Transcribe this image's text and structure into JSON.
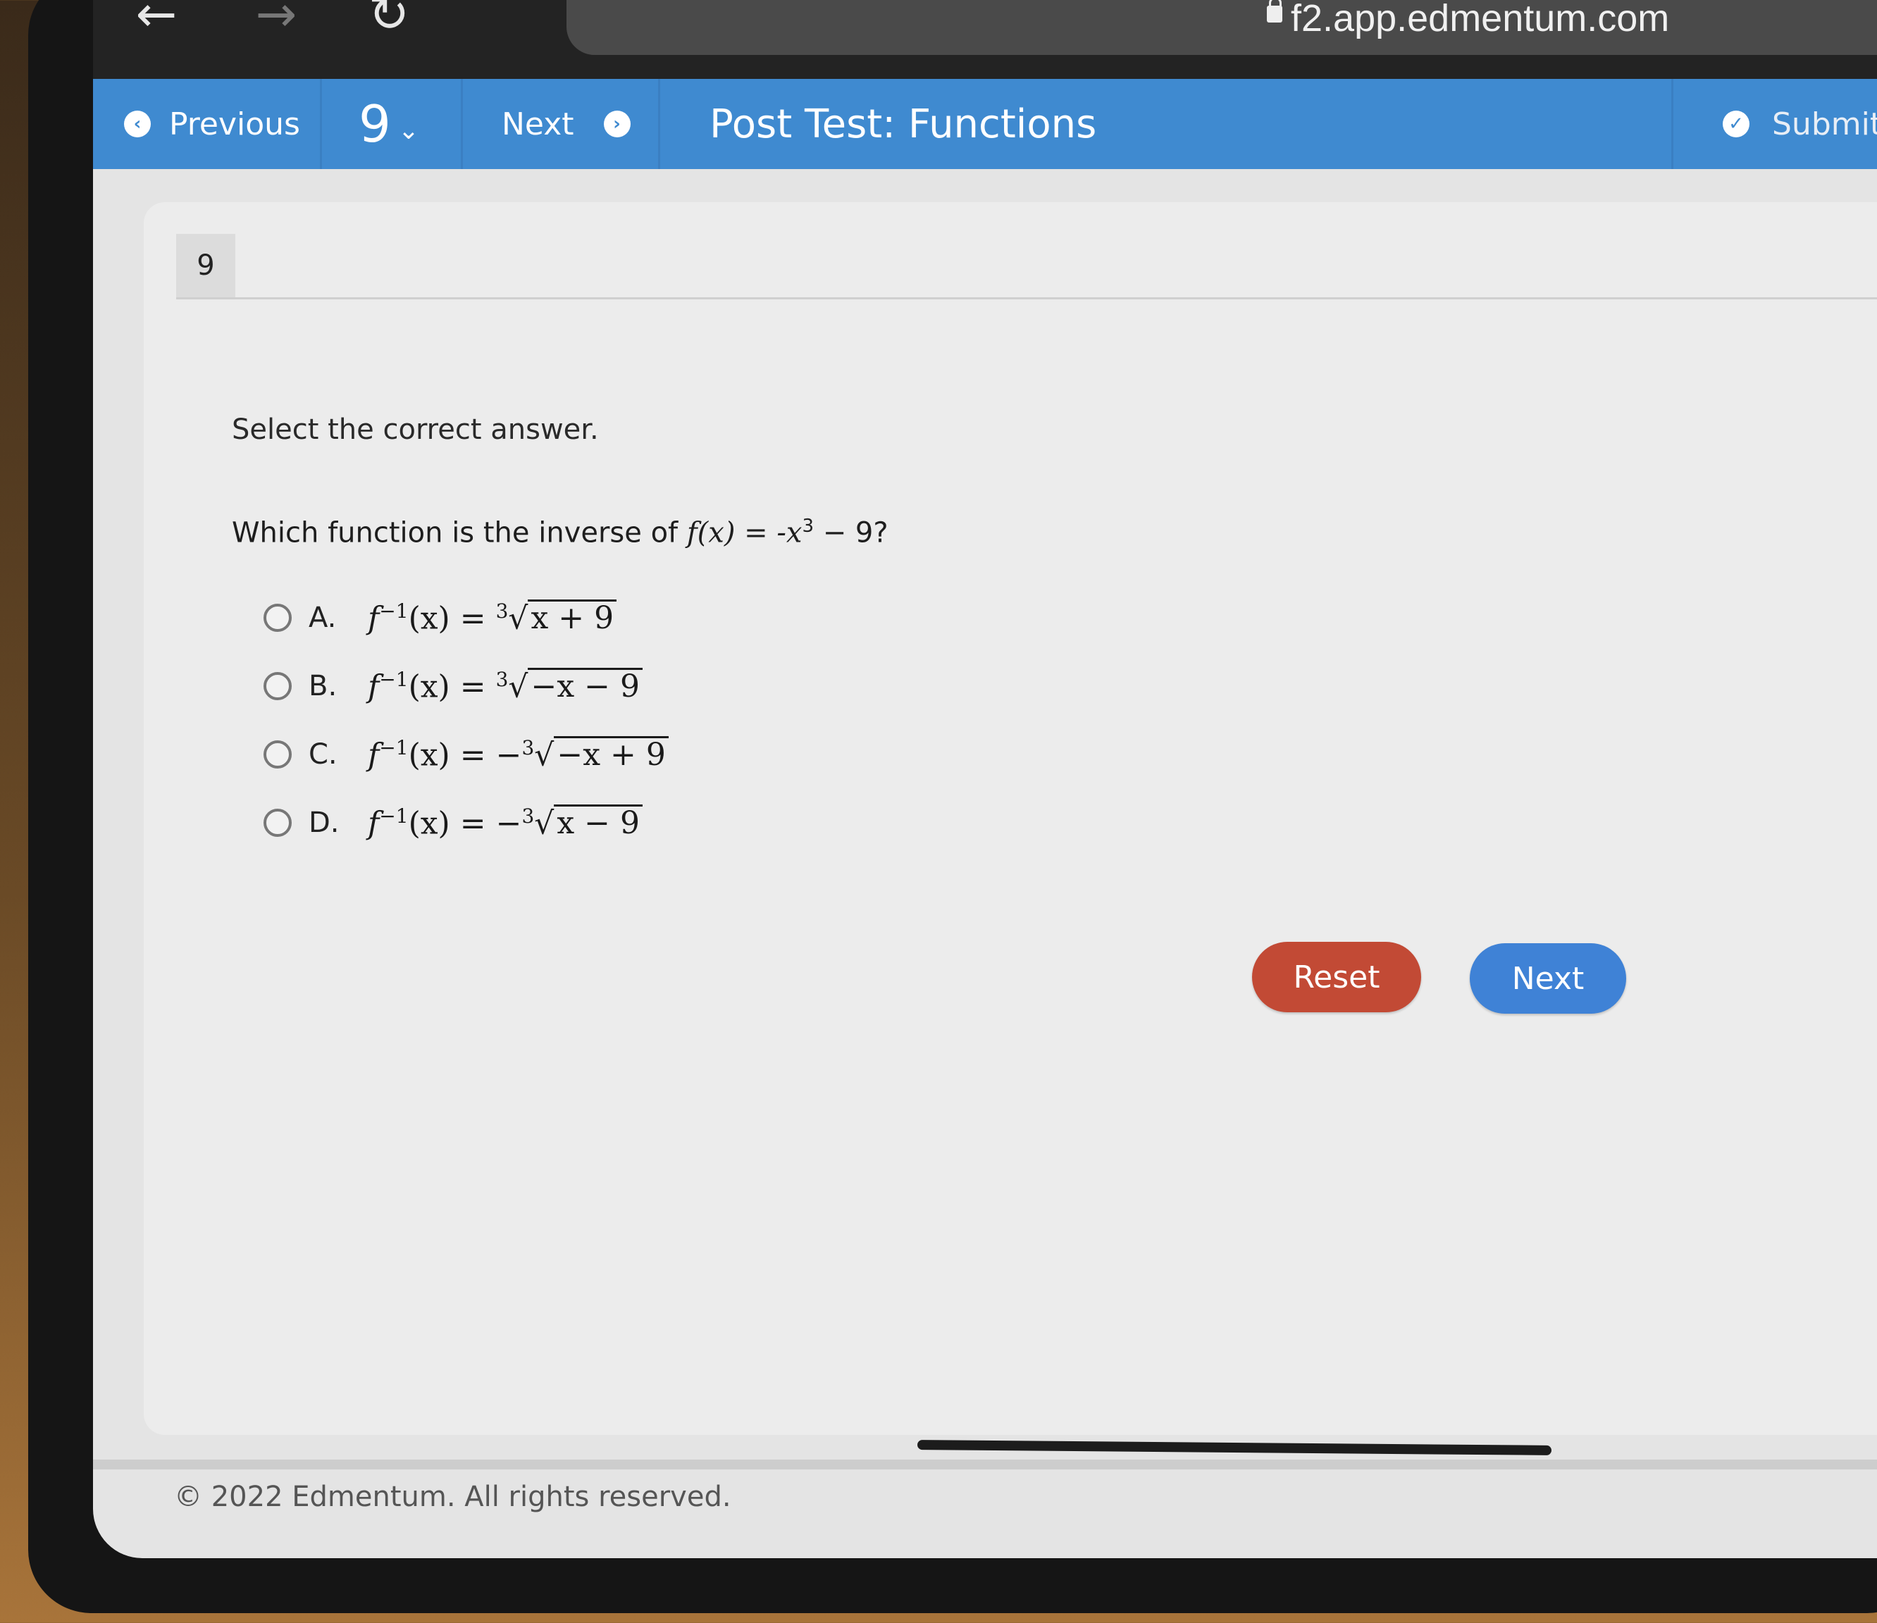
{
  "browser": {
    "back_icon": "arrow-left",
    "forward_icon": "arrow-right",
    "reload_icon": "reload",
    "url": "f2.app.edmentum.com",
    "lock_icon": "lock"
  },
  "toolbar": {
    "previous_label": "Previous",
    "question_selector": "9",
    "next_label": "Next",
    "title": "Post Test: Functions",
    "submit_label": "Submit Test",
    "accent_color": "#3f8ad0"
  },
  "question": {
    "number": "9",
    "instruction": "Select the correct answer.",
    "prompt_prefix": "Which function is the inverse of ",
    "prompt_func": "f(x) = -x",
    "prompt_exp": "3",
    "prompt_suffix": " − 9?",
    "options": [
      {
        "letter": "A.",
        "lhs": "f",
        "sup": "−1",
        "arg": "(x) = ",
        "neg": "",
        "index": "3",
        "radicand": "x + 9",
        "selected": false
      },
      {
        "letter": "B.",
        "lhs": "f",
        "sup": "−1",
        "arg": "(x) = ",
        "neg": "",
        "index": "3",
        "radicand": "−x − 9",
        "selected": false
      },
      {
        "letter": "C.",
        "lhs": "f",
        "sup": "−1",
        "arg": "(x) = ",
        "neg": "−",
        "index": "3",
        "radicand": "−x + 9",
        "selected": false
      },
      {
        "letter": "D.",
        "lhs": "f",
        "sup": "−1",
        "arg": "(x) = ",
        "neg": "−",
        "index": "3",
        "radicand": "x − 9",
        "selected": false
      }
    ]
  },
  "actions": {
    "reset_label": "Reset",
    "reset_color": "#c24a35",
    "next_label": "Next",
    "next_color": "#3f82d6"
  },
  "footer": {
    "copyright": "© 2022 Edmentum. All rights reserved."
  }
}
